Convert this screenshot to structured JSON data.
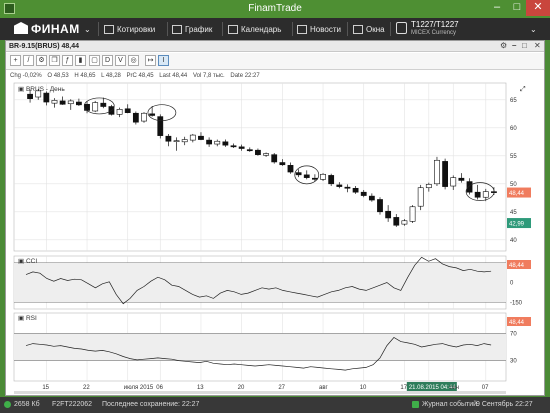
{
  "window": {
    "title": "FinamTrade"
  },
  "toolbar": {
    "logo": "ФИНАМ",
    "items": [
      {
        "label": "Котировки"
      },
      {
        "label": "График"
      },
      {
        "label": "Календарь"
      },
      {
        "label": "Новости"
      },
      {
        "label": "Окна"
      }
    ],
    "account": {
      "name": "T1227/T1227",
      "sub": "MICEX Currency"
    }
  },
  "chart_window": {
    "title": "BR-9.15(BRUS) 48,44",
    "tools": [
      "D",
      "V",
      "↦",
      "I"
    ],
    "ohlc": {
      "chg": "Chg -0,02%",
      "open": "O 48,53",
      "high": "H 48,65",
      "low": "L 48,28",
      "prev_close": "PrC 48,45",
      "last": "Last 48,44",
      "vol": "Vol 7,8 тыс.",
      "date": "Date 22:27"
    }
  },
  "chart_data": [
    {
      "type": "candlestick",
      "title": "BRUS - День",
      "y_ticks": [
        40,
        45,
        50,
        55,
        60,
        65
      ],
      "ylim": [
        38,
        68
      ],
      "x_ticks": [
        "15",
        "22",
        "июля 2015",
        "06",
        "13",
        "20",
        "27",
        "авг",
        "10",
        "17",
        "21.08.2015 04:44",
        "сен",
        "07"
      ],
      "candles": [
        {
          "o": 66.0,
          "h": 66.8,
          "l": 64.5,
          "c": 65.2
        },
        {
          "o": 65.5,
          "h": 66.9,
          "l": 65.0,
          "c": 66.6
        },
        {
          "o": 66.2,
          "h": 66.5,
          "l": 64.0,
          "c": 64.6
        },
        {
          "o": 64.4,
          "h": 65.3,
          "l": 63.6,
          "c": 64.9
        },
        {
          "o": 64.8,
          "h": 65.6,
          "l": 64.1,
          "c": 64.2
        },
        {
          "o": 64.3,
          "h": 65.1,
          "l": 63.2,
          "c": 64.8
        },
        {
          "o": 64.6,
          "h": 65.2,
          "l": 63.9,
          "c": 64.1
        },
        {
          "o": 64.2,
          "h": 64.7,
          "l": 62.6,
          "c": 63.1
        },
        {
          "o": 63.0,
          "h": 64.8,
          "l": 62.8,
          "c": 64.5
        },
        {
          "o": 64.4,
          "h": 65.4,
          "l": 63.5,
          "c": 63.8
        },
        {
          "o": 63.8,
          "h": 64.1,
          "l": 62.2,
          "c": 62.4
        },
        {
          "o": 62.4,
          "h": 63.6,
          "l": 61.9,
          "c": 63.3
        },
        {
          "o": 63.4,
          "h": 64.2,
          "l": 62.6,
          "c": 62.7
        },
        {
          "o": 62.6,
          "h": 62.9,
          "l": 60.6,
          "c": 61.0
        },
        {
          "o": 61.2,
          "h": 62.8,
          "l": 60.9,
          "c": 62.6
        },
        {
          "o": 62.5,
          "h": 63.9,
          "l": 62.0,
          "c": 62.2
        },
        {
          "o": 62.0,
          "h": 62.4,
          "l": 58.1,
          "c": 58.6
        },
        {
          "o": 58.5,
          "h": 58.9,
          "l": 56.7,
          "c": 57.6
        },
        {
          "o": 57.6,
          "h": 58.3,
          "l": 55.9,
          "c": 57.7
        },
        {
          "o": 57.5,
          "h": 58.4,
          "l": 56.9,
          "c": 57.9
        },
        {
          "o": 57.8,
          "h": 58.9,
          "l": 57.4,
          "c": 58.7
        },
        {
          "o": 58.5,
          "h": 59.2,
          "l": 57.8,
          "c": 57.9
        },
        {
          "o": 57.8,
          "h": 58.3,
          "l": 56.6,
          "c": 57.1
        },
        {
          "o": 57.1,
          "h": 57.9,
          "l": 56.7,
          "c": 57.6
        },
        {
          "o": 57.5,
          "h": 57.9,
          "l": 56.6,
          "c": 56.9
        },
        {
          "o": 56.8,
          "h": 57.2,
          "l": 56.4,
          "c": 56.6
        },
        {
          "o": 56.6,
          "h": 57.0,
          "l": 55.9,
          "c": 56.3
        },
        {
          "o": 56.1,
          "h": 56.5,
          "l": 55.7,
          "c": 55.9
        },
        {
          "o": 56.0,
          "h": 56.3,
          "l": 55.0,
          "c": 55.2
        },
        {
          "o": 55.1,
          "h": 55.6,
          "l": 54.8,
          "c": 55.4
        },
        {
          "o": 55.2,
          "h": 55.5,
          "l": 53.6,
          "c": 53.9
        },
        {
          "o": 53.8,
          "h": 54.4,
          "l": 53.2,
          "c": 53.4
        },
        {
          "o": 53.3,
          "h": 53.8,
          "l": 51.8,
          "c": 52.1
        },
        {
          "o": 52.0,
          "h": 52.6,
          "l": 51.2,
          "c": 51.6
        },
        {
          "o": 51.6,
          "h": 52.4,
          "l": 50.8,
          "c": 51.1
        },
        {
          "o": 51.0,
          "h": 51.7,
          "l": 50.4,
          "c": 50.8
        },
        {
          "o": 50.8,
          "h": 51.9,
          "l": 50.5,
          "c": 51.7
        },
        {
          "o": 51.5,
          "h": 51.8,
          "l": 49.6,
          "c": 50.0
        },
        {
          "o": 49.8,
          "h": 50.3,
          "l": 49.2,
          "c": 49.5
        },
        {
          "o": 49.4,
          "h": 49.9,
          "l": 48.5,
          "c": 49.2
        },
        {
          "o": 49.2,
          "h": 49.6,
          "l": 48.2,
          "c": 48.5
        },
        {
          "o": 48.5,
          "h": 48.9,
          "l": 47.6,
          "c": 47.9
        },
        {
          "o": 47.8,
          "h": 48.3,
          "l": 46.8,
          "c": 47.1
        },
        {
          "o": 47.2,
          "h": 47.6,
          "l": 44.5,
          "c": 45.0
        },
        {
          "o": 45.1,
          "h": 46.2,
          "l": 43.2,
          "c": 43.9
        },
        {
          "o": 44.0,
          "h": 44.6,
          "l": 42.3,
          "c": 42.6
        },
        {
          "o": 42.8,
          "h": 43.7,
          "l": 42.5,
          "c": 43.4
        },
        {
          "o": 43.3,
          "h": 46.2,
          "l": 43.0,
          "c": 45.9
        },
        {
          "o": 46.0,
          "h": 49.8,
          "l": 45.3,
          "c": 49.3
        },
        {
          "o": 49.3,
          "h": 50.2,
          "l": 48.6,
          "c": 49.9
        },
        {
          "o": 50.0,
          "h": 54.8,
          "l": 49.6,
          "c": 54.2
        },
        {
          "o": 54.0,
          "h": 54.5,
          "l": 49.0,
          "c": 49.5
        },
        {
          "o": 49.6,
          "h": 51.5,
          "l": 48.9,
          "c": 51.1
        },
        {
          "o": 51.0,
          "h": 51.9,
          "l": 50.2,
          "c": 50.6
        },
        {
          "o": 50.4,
          "h": 51.0,
          "l": 48.1,
          "c": 48.5
        },
        {
          "o": 48.5,
          "h": 49.8,
          "l": 47.2,
          "c": 47.6
        },
        {
          "o": 47.6,
          "h": 49.1,
          "l": 46.9,
          "c": 48.6
        },
        {
          "o": 48.6,
          "h": 49.4,
          "l": 48.0,
          "c": 48.44
        }
      ],
      "last_price": "48,44",
      "price_marker_low": "42,99"
    },
    {
      "type": "line",
      "title": "CCI",
      "y_ticks": [
        "150",
        "0",
        "-150"
      ],
      "ylim": [
        -200,
        200
      ],
      "values": [
        60,
        80,
        70,
        30,
        10,
        30,
        15,
        25,
        20,
        -10,
        -40,
        -10,
        5,
        -90,
        -160,
        -120,
        -60,
        -30,
        10,
        40,
        20,
        -20,
        -30,
        -60,
        -90,
        -110,
        -100,
        -120,
        -80,
        -60,
        -70,
        -90,
        -80,
        -60,
        -40,
        -50,
        -40,
        -60,
        -70,
        -80,
        -90,
        -100,
        -110,
        -90,
        -70,
        -60,
        -40,
        -30,
        -50,
        -60,
        -40,
        -20,
        0,
        -40,
        -60,
        40,
        130,
        190,
        160,
        180,
        140,
        120,
        110,
        90,
        100,
        85,
        80,
        85
      ],
      "last_value": "48,44"
    },
    {
      "type": "line",
      "title": "RSI",
      "y_ticks": [
        "70",
        "30"
      ],
      "ylim": [
        0,
        100
      ],
      "values": [
        52,
        55,
        54,
        53,
        51,
        52,
        50,
        48,
        47,
        45,
        44,
        45,
        43,
        40,
        36,
        33,
        31,
        32,
        33,
        34,
        33,
        32,
        30,
        29,
        28,
        27,
        29,
        26,
        25,
        24,
        25,
        24,
        23,
        22,
        23,
        24,
        23,
        22,
        21,
        20,
        19,
        21,
        20,
        19,
        18,
        17,
        16,
        18,
        19,
        20,
        24,
        34,
        52,
        64,
        58,
        56,
        54,
        50,
        52,
        54,
        55,
        52,
        50,
        53,
        54,
        52,
        55,
        53
      ],
      "last_value": "48,44"
    }
  ],
  "status": {
    "net": "2658 Кб",
    "f2": "F2FT222062",
    "saved": "Последнее сохранение: 22:27",
    "journal": "Журнал событий",
    "date": "9 Сентябрь 22:27"
  },
  "colors": {
    "frame": "#4e8f33",
    "toolbar": "#2c2c2c",
    "price_marker": "#f07c5e",
    "price_marker_low": "#2e9a7a",
    "date_marker": "#2e7d5b"
  }
}
